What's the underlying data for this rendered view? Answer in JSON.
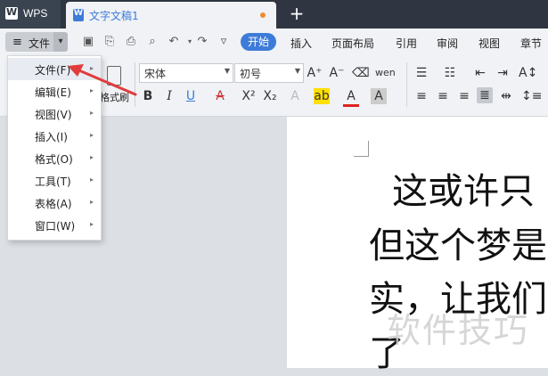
{
  "titlebar": {
    "app_tab": "WPS",
    "doc_tab": "文字文稿1",
    "new_tab_icon": "plus-icon"
  },
  "menubar": {
    "file_label": "文件",
    "tabs": [
      "开始",
      "插入",
      "页面布局",
      "引用",
      "审阅",
      "视图",
      "章节"
    ]
  },
  "ribbon": {
    "font_name": "宋体",
    "font_size": "初号",
    "format_painter_label": "格式刷"
  },
  "file_menu": {
    "items": [
      {
        "label": "文件(F)"
      },
      {
        "label": "编辑(E)"
      },
      {
        "label": "视图(V)"
      },
      {
        "label": "插入(I)"
      },
      {
        "label": "格式(O)"
      },
      {
        "label": "工具(T)"
      },
      {
        "label": "表格(A)"
      },
      {
        "label": "窗口(W)"
      }
    ]
  },
  "document": {
    "lines": [
      "这或许只",
      "但这个梦是",
      "实，让我们",
      "了"
    ]
  },
  "watermark": "软件技巧",
  "colors": {
    "accent": "#3d7bd9",
    "annotation_arrow": "#e03c3c"
  }
}
